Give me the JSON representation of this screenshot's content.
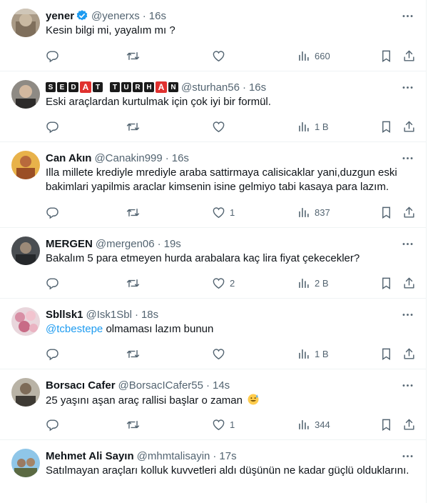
{
  "tweets": [
    {
      "name": "yener",
      "verified": true,
      "handle": "@yenerxs",
      "time": "16s",
      "text": "Kesin bilgi mi, yayalım mı ?",
      "reply": "",
      "retweet": "",
      "like": "",
      "views": "660"
    },
    {
      "name": "SEDAT TURHAN",
      "name_letters": [
        "S",
        "E",
        "D",
        "A",
        "T",
        "T",
        "U",
        "R",
        "H",
        "A",
        "N"
      ],
      "handle": "@sturhan56",
      "time": "16s",
      "text": "Eski araçlardan kurtulmak için çok iyi bir formül.",
      "reply": "",
      "retweet": "",
      "like": "",
      "views": "1 B"
    },
    {
      "name": "Can Akın",
      "handle": "@Canakin999",
      "time": "16s",
      "text": "Illa millete krediyle mrediyle araba sattirmaya calisicaklar yani,duzgun eski bakimlari yapilmis araclar kimsenin isine gelmiyo tabi kasaya para lazım.",
      "reply": "",
      "retweet": "",
      "like": "1",
      "views": "837"
    },
    {
      "name": "MERGEN",
      "handle": "@mergen06",
      "time": "19s",
      "text": "Bakalım 5 para etmeyen hurda arabalara kaç lira fiyat çekecekler?",
      "reply": "",
      "retweet": "",
      "like": "2",
      "views": "2 B"
    },
    {
      "name": "Sbllsk1",
      "handle": "@Isk1Sbl",
      "time": "18s",
      "mention": "@tcbestepe",
      "text": " olmaması lazım bunun",
      "reply": "",
      "retweet": "",
      "like": "",
      "views": "1 B"
    },
    {
      "name": "Borsacı Cafer",
      "handle": "@BorsacICafer55",
      "time": "14s",
      "text": "25 yaşını aşan araç rallisi başlar o zaman ",
      "emoji": "sweat-smile-emoji",
      "reply": "",
      "retweet": "",
      "like": "1",
      "views": "344"
    },
    {
      "name": "Mehmet Ali Sayın",
      "handle": "@mhmtalisayin",
      "time": "17s",
      "text": "Satılmayan araçları kolluk kuvvetleri aldı düşünün ne kadar güçlü olduklarını."
    }
  ],
  "separator": "·",
  "colors": {
    "text": "#0f1419",
    "muted": "#536471",
    "link": "#1d9bf0",
    "border": "#eff3f4",
    "verified": "#1d9bf0"
  },
  "icons": [
    "reply-icon",
    "retweet-icon",
    "like-icon",
    "views-icon",
    "bookmark-icon",
    "share-icon",
    "more-icon",
    "verified-badge-icon"
  ]
}
